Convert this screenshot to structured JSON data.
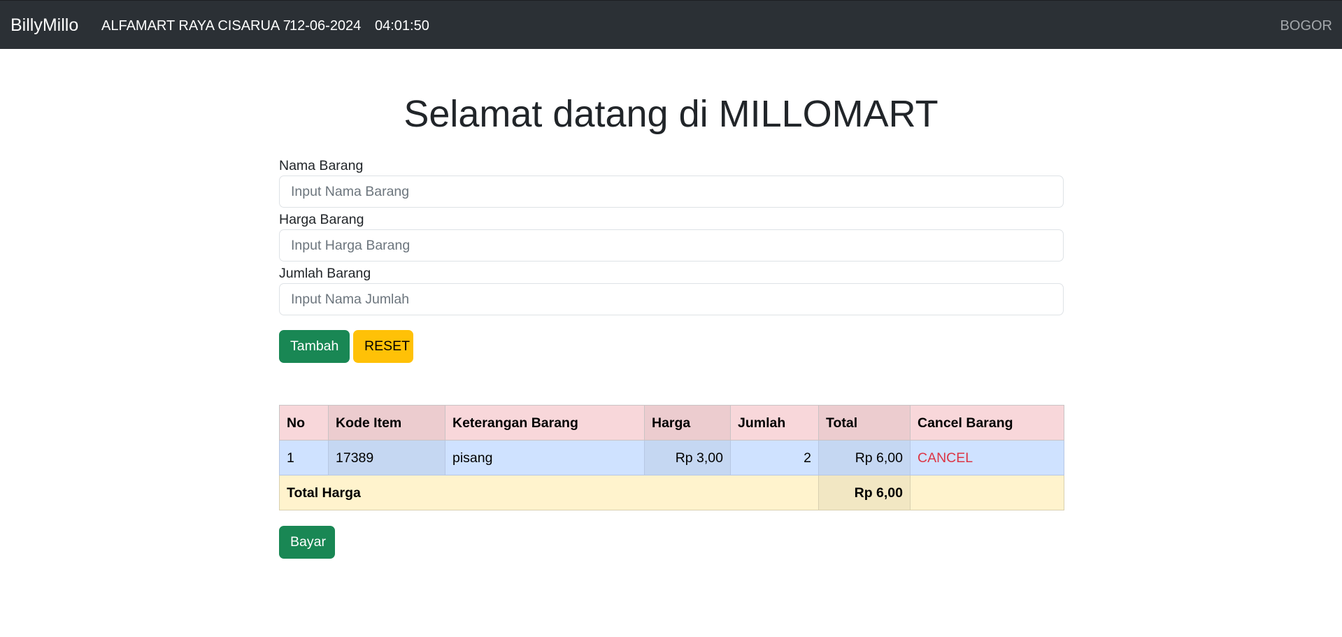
{
  "navbar": {
    "brand": "BillyMillo",
    "store": "ALFAMART RAYA CISARUA 7",
    "date": "12-06-2024",
    "time": "04:01:50",
    "city": "BOGOR"
  },
  "page_title": "Selamat datang di MILLOMART",
  "form": {
    "nama": {
      "label": "Nama Barang",
      "placeholder": "Input Nama Barang",
      "value": ""
    },
    "harga": {
      "label": "Harga Barang",
      "placeholder": "Input Harga Barang",
      "value": ""
    },
    "jumlah": {
      "label": "Jumlah Barang",
      "placeholder": "Input Nama Jumlah",
      "value": ""
    },
    "add_label": "Tambah",
    "reset_label": "RESET"
  },
  "table": {
    "headers": [
      "No",
      "Kode Item",
      "Keterangan Barang",
      "Harga",
      "Jumlah",
      "Total",
      "Cancel Barang"
    ],
    "rows": [
      {
        "no": "1",
        "kode": "17389",
        "keterangan": "pisang",
        "harga": "Rp 3,00",
        "jumlah": "2",
        "total": "Rp 6,00",
        "cancel": "CANCEL"
      }
    ],
    "total_label": "Total Harga",
    "total_value": "Rp 6,00"
  },
  "pay_label": "Bayar",
  "colors": {
    "navbar_bg": "#2b3035",
    "success": "#198754",
    "warning": "#ffc107",
    "danger": "#dc3545",
    "table_header": "#f8d7da",
    "table_row": "#cfe2ff",
    "table_total": "#fff3cd"
  }
}
